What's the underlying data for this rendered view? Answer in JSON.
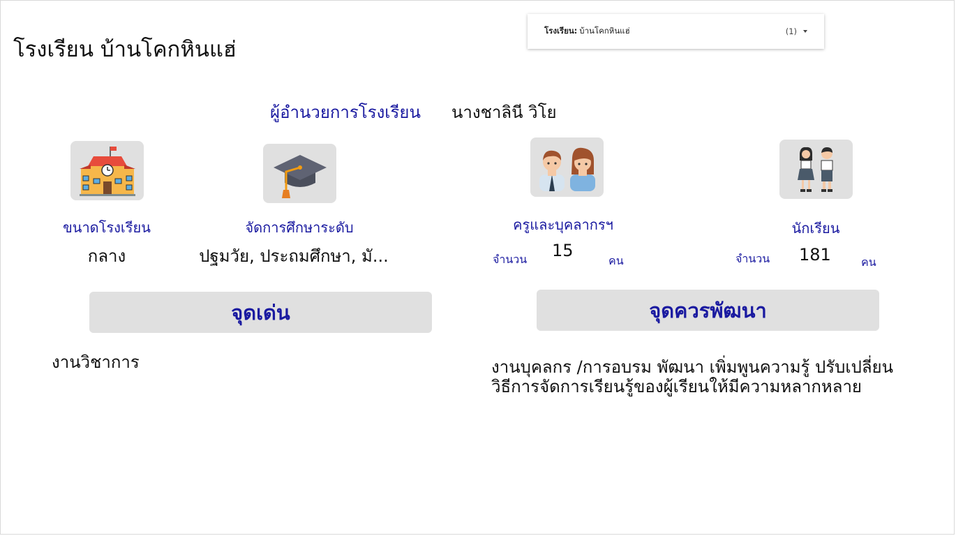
{
  "school": {
    "title": "โรงเรียน บ้านโคกหินแฮ่"
  },
  "filter": {
    "label": "โรงเรียน:",
    "value": "บ้านโคกหินแฮ่",
    "count": "(1)"
  },
  "director": {
    "label": "ผู้อำนวยการโรงเรียน",
    "name": "นางชาลินี วิโย"
  },
  "size": {
    "label": "ขนาดโรงเรียน",
    "value": "กลาง"
  },
  "levels": {
    "label": "จัดการศึกษาระดับ",
    "value": "ปฐมวัย, ประถมศึกษา, มั..."
  },
  "teachers": {
    "label": "ครูและบุคลากรฯ",
    "count_prefix": "จำนวน",
    "count": "15",
    "unit": "คน"
  },
  "students": {
    "label": "นักเรียน",
    "count_prefix": "จำนวน",
    "count": "181",
    "unit": "คน"
  },
  "strengths": {
    "title": "จุดเด่น",
    "text": "งานวิชาการ"
  },
  "improvements": {
    "title": "จุดควรพัฒนา",
    "text": "งานบุคลกร /การอบรม พัฒนา เพิ่มพูนความรู้ ปรับเปลี่ยนวิธีการจัดการเรียนรู้ของผู้เรียนให้มีความหลากหลาย"
  },
  "icons": {
    "school": "school-building-icon",
    "graduation": "graduation-cap-icon",
    "teachers": "teachers-icon",
    "students": "students-icon"
  },
  "colors": {
    "accent_blue": "#1a1aa0",
    "panel_gray": "#e0e0e0"
  }
}
